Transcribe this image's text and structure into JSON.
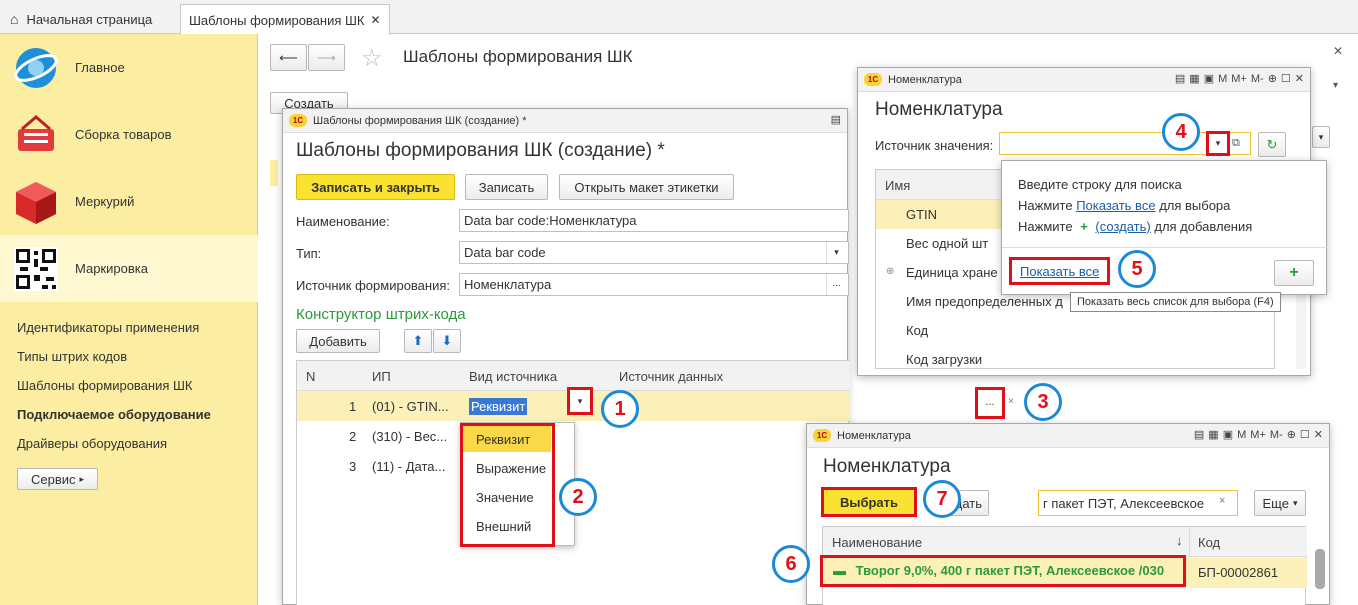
{
  "tabs": {
    "home": "Начальная страница",
    "current": "Шаблоны формирования ШК"
  },
  "sidebar": {
    "sections": [
      {
        "label": "Главное",
        "icon": "globe-icon"
      },
      {
        "label": "Сборка товаров",
        "icon": "basket-icon"
      },
      {
        "label": "Меркурий",
        "icon": "cube-icon"
      },
      {
        "label": "Маркировка",
        "icon": "qr-code-icon"
      }
    ],
    "links": [
      "Идентификаторы применения",
      "Типы штрих кодов",
      "Шаблоны формирования ШК",
      "Подключаемое оборудование",
      "Драйверы оборудования"
    ],
    "service": "Сервис"
  },
  "main": {
    "title": "Шаблоны формирования ШК",
    "create_btn": "Создать"
  },
  "form": {
    "window_title": "Шаблоны формирования ШК (создание) *",
    "title": "Шаблоны формирования ШК (создание) *",
    "save_close": "Записать и закрыть",
    "save": "Записать",
    "open_layout": "Открыть макет этикетки",
    "name_label": "Наименование:",
    "name_value": "Data bar code:Номенклатура",
    "type_label": "Тип:",
    "type_value": "Data bar code",
    "source_label": "Источник формирования:",
    "source_value": "Номенклатура",
    "constructor": "Конструктор штрих-кода",
    "add": "Добавить",
    "columns": [
      "N",
      "ИП",
      "Вид источника",
      "Источник данных"
    ],
    "rows": [
      {
        "n": "1",
        "ip": "(01) - GTIN...",
        "kind": "Реквизит"
      },
      {
        "n": "2",
        "ip": "(310) - Вес..."
      },
      {
        "n": "3",
        "ip": "(11) - Дата..."
      }
    ],
    "dropdown": [
      "Реквизит",
      "Выражение",
      "Значение",
      "Внешний"
    ]
  },
  "nom1": {
    "window_title": "Номенклатура",
    "title": "Номенклатура",
    "source_label": "Источник значения:",
    "col_name": "Имя",
    "items": [
      "GTIN",
      "Вес одной шт",
      "Единица хране",
      "Имя предопределенных д",
      "Код",
      "Код загрузки"
    ],
    "hint1": "Введите строку для поиска",
    "hint2a": "Нажмите",
    "hint2_link": "Показать все",
    "hint2b": "для выбора",
    "hint3a": "Нажмите",
    "hint3_link": "(создать)",
    "hint3b": "для добавления",
    "show_all": "Показать все",
    "tooltip": "Показать весь список для выбора (F4)"
  },
  "nom2": {
    "window_title": "Номенклатура",
    "title": "Номенклатура",
    "select": "Выбрать",
    "create_partial": "здать",
    "search": "г пакет ПЭТ, Алексеевское",
    "more": "Еще",
    "col_name": "Наименование",
    "col_code": "Код",
    "row_name": "Творог 9,0%, 400 г пакет ПЭТ, Алексеевское /030",
    "row_code": "БП-00002861"
  },
  "badges": [
    "1",
    "2",
    "3",
    "4",
    "5",
    "6",
    "7"
  ],
  "colors": {
    "accent_red": "#e0101a",
    "badge_blue": "#1a8ad8",
    "sidebar_yellow": "#fbeda1",
    "button_yellow": "#f9e230"
  }
}
